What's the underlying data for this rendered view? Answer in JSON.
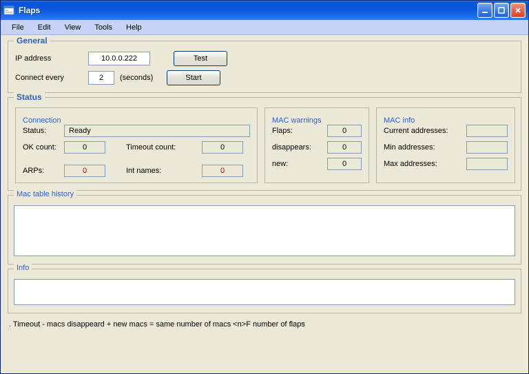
{
  "window": {
    "title": "Flaps"
  },
  "menu": {
    "file": "File",
    "edit": "Edit",
    "view": "View",
    "tools": "Tools",
    "help": "Help"
  },
  "general": {
    "legend": "General",
    "ip_label": "IP address",
    "ip_value": "10.0.0.222",
    "connect_label": "Connect every",
    "connect_value": "2",
    "seconds_label": "(seconds)",
    "test_btn": "Test",
    "start_btn": "Start"
  },
  "status": {
    "legend": "Status",
    "connection": {
      "legend": "Connection",
      "status_label": "Status:",
      "status_value": "Ready",
      "ok_label": "OK count:",
      "ok_value": "0",
      "timeout_label": "Timeout count:",
      "timeout_value": "0",
      "arps_label": "ARPs:",
      "arps_value": "0",
      "intnames_label": "Int names:",
      "intnames_value": "0"
    },
    "mac_warnings": {
      "legend": "MAC warnings",
      "flaps_label": "Flaps:",
      "flaps_value": "0",
      "disappears_label": "disappears:",
      "disappears_value": "0",
      "new_label": "new:",
      "new_value": "0"
    },
    "mac_info": {
      "legend": "MAC info",
      "current_label": "Current addresses:",
      "current_value": "",
      "min_label": "Min addresses:",
      "min_value": "",
      "max_label": "Max addresses:",
      "max_value": ""
    }
  },
  "history": {
    "legend": "Mac table  history",
    "value": ""
  },
  "info": {
    "legend": "Info",
    "value": ""
  },
  "footer_legend": ". Timeout    - macs disappeard    + new macs    = same number of macs    <n>F number of flaps"
}
